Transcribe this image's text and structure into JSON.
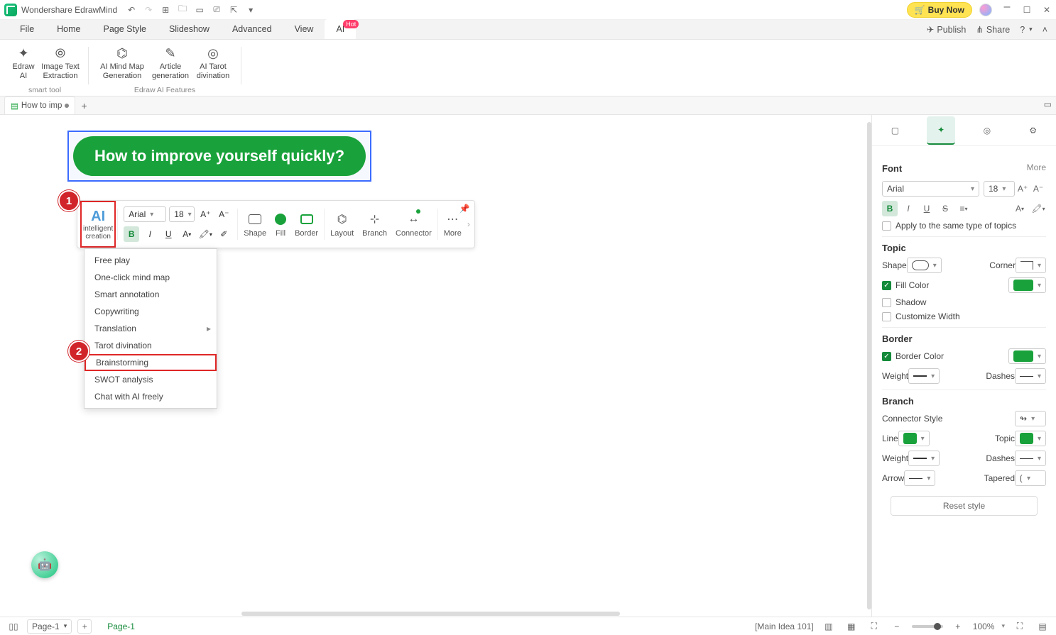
{
  "titlebar": {
    "app_name": "Wondershare EdrawMind",
    "buy_now": "Buy Now"
  },
  "menus": {
    "items": [
      "File",
      "Home",
      "Page Style",
      "Slideshow",
      "Advanced",
      "View",
      "AI"
    ],
    "active": 6,
    "hot_badge": "Hot",
    "right": {
      "publish": "Publish",
      "share": "Share"
    }
  },
  "ribbon": {
    "group1_label": "smart tool",
    "group2_label": "Edraw AI Features",
    "btns": [
      {
        "label": "Edraw\nAI"
      },
      {
        "label": "Image Text\nExtraction"
      },
      {
        "label": "AI Mind Map\nGeneration"
      },
      {
        "label": "Article\ngeneration"
      },
      {
        "label": "AI Tarot\ndivination"
      }
    ]
  },
  "doctab": {
    "name": "How to imp",
    "add": "+"
  },
  "node": {
    "text": "How to improve yourself quickly?"
  },
  "float_toolbar": {
    "ai_label": "intelligent\ncreation",
    "font": "Arial",
    "size": "18",
    "shape": "Shape",
    "fill": "Fill",
    "border": "Border",
    "layout": "Layout",
    "branch": "Branch",
    "connector": "Connector",
    "more": "More"
  },
  "dropdown": {
    "items": [
      "Free play",
      "One-click mind map",
      "Smart annotation",
      "Copywriting",
      "Translation",
      "Tarot divination",
      "Brainstorming",
      "SWOT analysis",
      "Chat with AI freely"
    ],
    "submenu_index": 4,
    "highlight_index": 6
  },
  "badges": {
    "n1": "1",
    "n2": "2"
  },
  "side": {
    "font_title": "Font",
    "more": "More",
    "font_name": "Arial",
    "font_size": "18",
    "apply_same": "Apply to the same type of topics",
    "topic_title": "Topic",
    "shape": "Shape",
    "corner": "Corner",
    "fill_color": "Fill Color",
    "shadow": "Shadow",
    "custom_width": "Customize Width",
    "border_title": "Border",
    "border_color": "Border Color",
    "weight": "Weight",
    "dashes": "Dashes",
    "branch_title": "Branch",
    "conn_style": "Connector Style",
    "line": "Line",
    "topic_line": "Topic",
    "weight2": "Weight",
    "dashes2": "Dashes",
    "arrow": "Arrow",
    "tapered": "Tapered",
    "reset": "Reset style",
    "colors": {
      "green": "#19a23b"
    }
  },
  "status": {
    "page_dd": "Page-1",
    "page_link": "Page-1",
    "node_info": "[Main Idea 101]",
    "zoom": "100%"
  }
}
